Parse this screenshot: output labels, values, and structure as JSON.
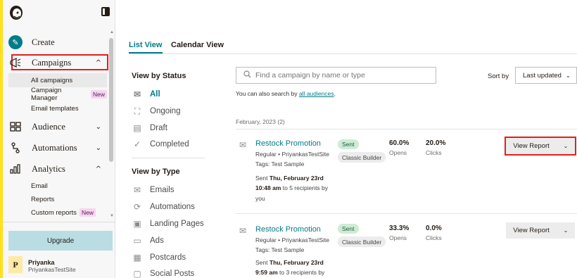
{
  "sidebar": {
    "create_label": "Create",
    "campaigns_label": "Campaigns",
    "campaign_subitems": [
      {
        "label": "All campaigns",
        "badge": ""
      },
      {
        "label": "Campaign Manager",
        "badge": "New"
      },
      {
        "label": "Email templates",
        "badge": ""
      }
    ],
    "audience_label": "Audience",
    "automations_label": "Automations",
    "analytics_label": "Analytics",
    "analytics_subitems": [
      {
        "label": "Email",
        "badge": ""
      },
      {
        "label": "Reports",
        "badge": ""
      },
      {
        "label": "Custom reports",
        "badge": "New"
      }
    ],
    "upgrade_label": "Upgrade",
    "user": {
      "initial": "P",
      "name": "Priyanka",
      "site": "PriyankasTestSite"
    }
  },
  "tabs": [
    {
      "label": "List View",
      "active": true
    },
    {
      "label": "Calendar View",
      "active": false
    }
  ],
  "filters": {
    "status_heading": "View by Status",
    "status_items": [
      "All",
      "Ongoing",
      "Draft",
      "Completed"
    ],
    "type_heading": "View by Type",
    "type_items": [
      "Emails",
      "Automations",
      "Landing Pages",
      "Ads",
      "Postcards",
      "Social Posts"
    ]
  },
  "search": {
    "placeholder": "Find a campaign by name or type",
    "hint_prefix": "You can also search by",
    "hint_link": "all audiences",
    "hint_suffix": "."
  },
  "sort": {
    "label": "Sort by",
    "selected": "Last updated"
  },
  "group_label": "February, 2023 (2)",
  "campaigns": [
    {
      "title": "Restock Promotion",
      "meta": "Regular • PriyankasTestSite",
      "tags": "Tags: Test Sample",
      "sent_prefix": "Sent",
      "sent_date": "Thu, February 23rd",
      "sent_time": "10:48 am",
      "sent_suffix": "to 5 recipients by",
      "sent_by": "you",
      "status": "Sent",
      "builder": "Classic Builder",
      "opens_value": "60.0%",
      "opens_label": "Opens",
      "clicks_value": "20.0%",
      "clicks_label": "Clicks",
      "action_label": "View Report"
    },
    {
      "title": "Restock Promotion",
      "meta": "Regular • PriyankasTestSite",
      "tags": "Tags: Test Sample",
      "sent_prefix": "Sent",
      "sent_date": "Thu, February 23rd",
      "sent_time": "9:59 am",
      "sent_suffix": "to 3 recipients by",
      "sent_by": "",
      "status": "Sent",
      "builder": "Classic Builder",
      "opens_value": "33.3%",
      "opens_label": "Opens",
      "clicks_value": "0.0%",
      "clicks_label": "Clicks",
      "action_label": "View Report"
    }
  ],
  "colors": {
    "accent": "#007c89",
    "highlight": "#e0201a",
    "brand_yellow": "#ffe01b"
  }
}
